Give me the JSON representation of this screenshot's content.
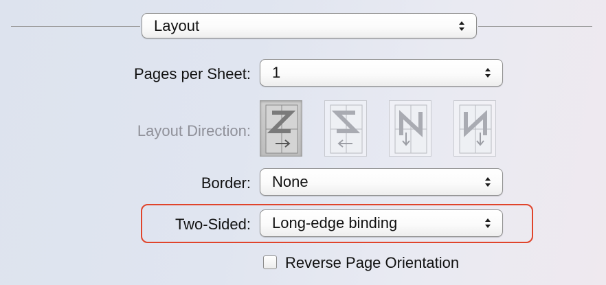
{
  "colors": {
    "highlight": "#e0442b",
    "disabled_text": "#8f9099"
  },
  "panel": {
    "selector": {
      "value": "Layout",
      "icon": "up-down-arrows-icon"
    }
  },
  "pages_per_sheet": {
    "label": "Pages per Sheet:",
    "value": "1"
  },
  "layout_direction": {
    "label": "Layout Direction:",
    "enabled": false,
    "options": [
      {
        "name": "z-left-to-right-icon",
        "selected": true
      },
      {
        "name": "s-right-to-left-icon",
        "selected": false
      },
      {
        "name": "n-top-to-bottom-icon",
        "selected": false
      },
      {
        "name": "n-mirrored-top-to-bottom-icon",
        "selected": false
      }
    ]
  },
  "border": {
    "label": "Border:",
    "value": "None"
  },
  "two_sided": {
    "label": "Two-Sided:",
    "value": "Long-edge binding",
    "highlighted": true
  },
  "reverse_orientation": {
    "label": "Reverse Page Orientation",
    "checked": false
  }
}
